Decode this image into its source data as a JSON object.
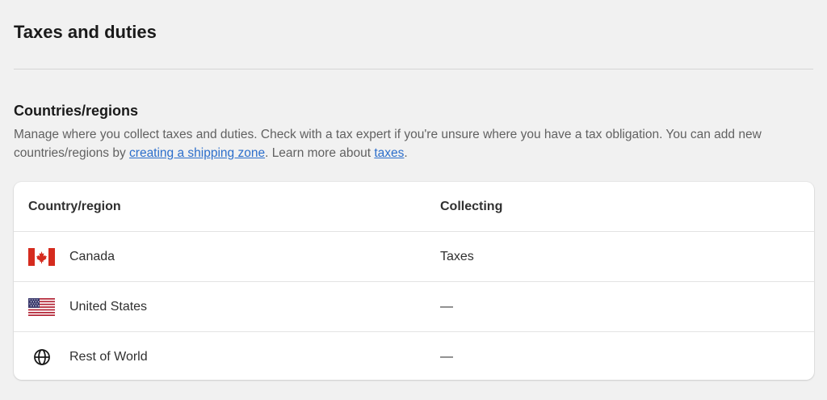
{
  "page": {
    "title": "Taxes and duties"
  },
  "section": {
    "heading": "Countries/regions",
    "description_part1": "Manage where you collect taxes and duties. Check with a tax expert if you're unsure where you have a tax obligation. You can add new countries/regions by ",
    "shipping_zone_link": "creating a shipping zone",
    "description_part2": ". Learn more about ",
    "taxes_link": "taxes",
    "description_part3": "."
  },
  "table": {
    "headers": {
      "country": "Country/region",
      "collecting": "Collecting"
    },
    "rows": [
      {
        "country": "Canada",
        "collecting": "Taxes",
        "icon": "canada-flag-icon"
      },
      {
        "country": "United States",
        "collecting": "—",
        "icon": "us-flag-icon"
      },
      {
        "country": "Rest of World",
        "collecting": "—",
        "icon": "globe-icon"
      }
    ]
  },
  "colors": {
    "background": "#f1f1f1",
    "card": "#ffffff",
    "link": "#2c6ecb",
    "canada_red": "#d52b1e",
    "us_blue": "#3c3b6e",
    "us_red": "#b22234"
  }
}
